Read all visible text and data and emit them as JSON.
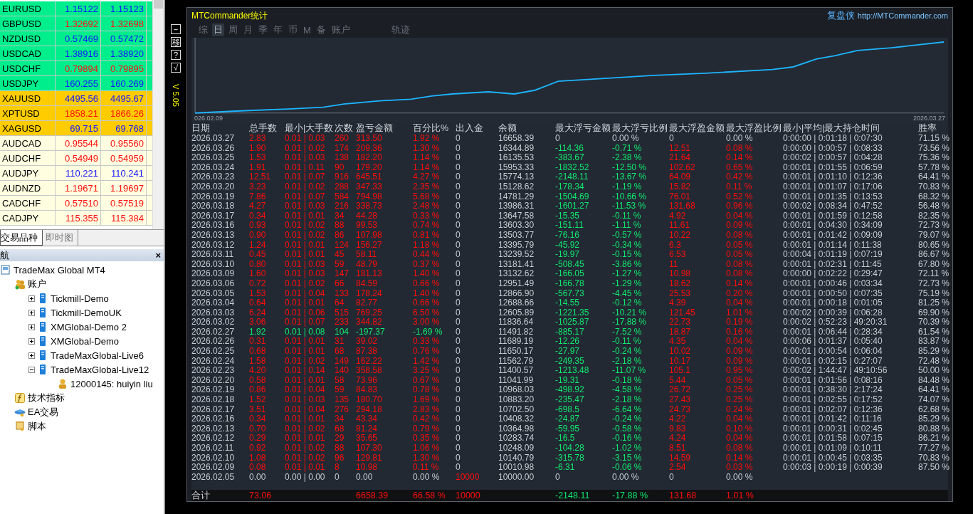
{
  "market_watch": {
    "symbols": [
      {
        "symbol": "EURUSD",
        "bid": "1.15122",
        "ask": "1.15123",
        "kind": "major",
        "rising": true
      },
      {
        "symbol": "GBPUSD",
        "bid": "1.32692",
        "ask": "1.32698",
        "kind": "major",
        "rising": false
      },
      {
        "symbol": "NZDUSD",
        "bid": "0.57469",
        "ask": "0.57472",
        "kind": "major",
        "rising": true
      },
      {
        "symbol": "USDCAD",
        "bid": "1.38916",
        "ask": "1.38920",
        "kind": "major",
        "rising": true
      },
      {
        "symbol": "USDCHF",
        "bid": "0.79894",
        "ask": "0.79895",
        "kind": "major",
        "rising": false
      },
      {
        "symbol": "USDJPY",
        "bid": "160.255",
        "ask": "160.269",
        "kind": "major",
        "rising": true
      },
      {
        "symbol": "XAUUSD",
        "bid": "4495.56",
        "ask": "4495.67",
        "kind": "metal",
        "rising": true
      },
      {
        "symbol": "XPTUSD",
        "bid": "1858.21",
        "ask": "1866.26",
        "kind": "metal",
        "rising": false
      },
      {
        "symbol": "XAGUSD",
        "bid": "69.715",
        "ask": "69.768",
        "kind": "metal",
        "rising": true
      },
      {
        "symbol": "AUDCAD",
        "bid": "0.95544",
        "ask": "0.95560",
        "kind": "cross",
        "rising": false
      },
      {
        "symbol": "AUDCHF",
        "bid": "0.54949",
        "ask": "0.54959",
        "kind": "cross",
        "rising": false
      },
      {
        "symbol": "AUDJPY",
        "bid": "110.221",
        "ask": "110.241",
        "kind": "cross",
        "rising": true
      },
      {
        "symbol": "AUDNZD",
        "bid": "1.19671",
        "ask": "1.19697",
        "kind": "cross",
        "rising": false
      },
      {
        "symbol": "CADCHF",
        "bid": "0.57510",
        "ask": "0.57519",
        "kind": "cross",
        "rising": false
      },
      {
        "symbol": "CADJPY",
        "bid": "115.355",
        "ask": "115.384",
        "kind": "cross",
        "rising": false
      }
    ],
    "tabs": [
      {
        "label": "交易品种",
        "selected": true
      },
      {
        "label": "即时图",
        "selected": false
      }
    ]
  },
  "navigator": {
    "title": "航",
    "close": "×",
    "root": {
      "label": "TradeMax Global MT4",
      "kind": "terminal",
      "children": [
        {
          "label": "账户",
          "kind": "accounts",
          "children": [
            {
              "label": "Tickmill-Demo",
              "kind": "server",
              "expanded": false
            },
            {
              "label": "Tickmill-DemoUK",
              "kind": "server",
              "expanded": false
            },
            {
              "label": "XMGlobal-Demo 2",
              "kind": "server",
              "expanded": false
            },
            {
              "label": "XMGlobal-Demo",
              "kind": "server",
              "expanded": false
            },
            {
              "label": "TradeMaxGlobal-Live6",
              "kind": "server",
              "expanded": false
            },
            {
              "label": "TradeMaxGlobal-Live12",
              "kind": "server",
              "expanded": true,
              "children": [
                {
                  "label": "12000145: huiyin liu",
                  "kind": "user"
                }
              ]
            }
          ]
        },
        {
          "label": "技术指标",
          "kind": "indicator"
        },
        {
          "label": "EA交易",
          "kind": "expert"
        },
        {
          "label": "脚本",
          "kind": "script"
        }
      ]
    }
  },
  "side_buttons": [
    "−",
    "移",
    "?",
    "√"
  ],
  "version": "V 5.05",
  "panel": {
    "title": "MTCommander统计",
    "brand": "复盘侠",
    "link": "http://MTCommander.com",
    "tabs": [
      {
        "label": "综",
        "selected": false
      },
      {
        "label": "日",
        "selected": true
      },
      {
        "label": "周",
        "selected": false
      },
      {
        "label": "月",
        "selected": false
      },
      {
        "label": "季",
        "selected": false
      },
      {
        "label": "年",
        "selected": false
      },
      {
        "label": "币",
        "selected": false
      },
      {
        "label": "M",
        "selected": false
      },
      {
        "label": "备",
        "selected": false
      },
      {
        "label": "账户",
        "selected": false
      },
      {
        "label": "轨迹",
        "selected": false
      }
    ],
    "chart": {
      "start_label": "026.02.09",
      "end_label": "2026.03.27"
    },
    "table": {
      "columns": [
        "日期",
        "总手数",
        "最小|大手数",
        "次数",
        "盈亏金额",
        "百分比%",
        "出入金",
        "余额",
        "最大浮亏金额",
        "最大浮亏比例",
        "最大浮盈金额",
        "最大浮盈比例",
        "最小|平均|最大持仓时间",
        "胜率"
      ],
      "rows": [
        {
          "kind": "gain",
          "floating": false,
          "cash_in": false,
          "cells": [
            "2026.03.27",
            "2.83",
            "0.01 | 0.03",
            "260",
            "313.50",
            "1.92 %",
            "0",
            "16658.39",
            "0",
            "0.00 %",
            "0",
            "0.00 %",
            "0:00:00 | 0:01:18 | 0:07:30",
            "71.15 %"
          ]
        },
        {
          "kind": "gain",
          "floating": true,
          "cash_in": false,
          "cells": [
            "2026.03.26",
            "1.90",
            "0.01 | 0.02",
            "174",
            "209.36",
            "1.30 %",
            "0",
            "16344.89",
            "-114.36",
            "-0.71 %",
            "12.51",
            "0.08 %",
            "0:00:00 | 0:00:57 | 0:08:33",
            "73.56 %"
          ]
        },
        {
          "kind": "gain",
          "floating": true,
          "cash_in": false,
          "cells": [
            "2026.03.25",
            "1.53",
            "0.01 | 0.03",
            "138",
            "182.20",
            "1.14 %",
            "0",
            "16135.53",
            "-383.67",
            "-2.38 %",
            "21.64",
            "0.14 %",
            "0:00:02 | 0:00:57 | 0:04:28",
            "75.36 %"
          ]
        },
        {
          "kind": "gain",
          "floating": true,
          "cash_in": false,
          "cells": [
            "2026.03.24",
            "1.91",
            "0.01 | 0.11",
            "90",
            "179.20",
            "1.14 %",
            "0",
            "15953.33",
            "-1832.52",
            "-12.50 %",
            "102.62",
            "0.65 %",
            "0:00:01 | 0:01:55 | 0:06:59",
            "57.78 %"
          ]
        },
        {
          "kind": "gain",
          "floating": true,
          "cash_in": false,
          "cells": [
            "2026.03.23",
            "12.51",
            "0.01 | 0.07",
            "916",
            "645.51",
            "4.27 %",
            "0",
            "15774.13",
            "-2148.11",
            "-13.67 %",
            "64.09",
            "0.42 %",
            "0:00:01 | 0:01:10 | 0:12:36",
            "64.41 %"
          ]
        },
        {
          "kind": "gain",
          "floating": true,
          "cash_in": false,
          "cells": [
            "2026.03.20",
            "3.23",
            "0.01 | 0.02",
            "288",
            "347.33",
            "2.35 %",
            "0",
            "15128.62",
            "-178.34",
            "-1.19 %",
            "15.82",
            "0.11 %",
            "0:00:01 | 0:01:07 | 0:17:06",
            "70.83 %"
          ]
        },
        {
          "kind": "gain",
          "floating": true,
          "cash_in": false,
          "cells": [
            "2026.03.19",
            "7.86",
            "0.01 | 0.07",
            "584",
            "794.98",
            "5.68 %",
            "0",
            "14781.29",
            "-1504.69",
            "-10.66 %",
            "76.01",
            "0.52 %",
            "0:00:01 | 0:01:35 | 0:13:53",
            "68.32 %"
          ]
        },
        {
          "kind": "gain",
          "floating": true,
          "cash_in": false,
          "cells": [
            "2026.03.18",
            "4.27",
            "0.01 | 0.03",
            "216",
            "338.73",
            "2.48 %",
            "0",
            "13986.31",
            "-1601.27",
            "-11.53 %",
            "131.68",
            "0.96 %",
            "0:00:02 | 0:08:34 | 0:47:52",
            "56.48 %"
          ]
        },
        {
          "kind": "gain",
          "floating": true,
          "cash_in": false,
          "cells": [
            "2026.03.17",
            "0.34",
            "0.01 | 0.01",
            "34",
            "44.28",
            "0.33 %",
            "0",
            "13647.58",
            "-15.35",
            "-0.11 %",
            "4.92",
            "0.04 %",
            "0:00:01 | 0:01:59 | 0:12:58",
            "82.35 %"
          ]
        },
        {
          "kind": "gain",
          "floating": true,
          "cash_in": false,
          "cells": [
            "2026.03.16",
            "0.93",
            "0.01 | 0.02",
            "88",
            "99.53",
            "0.74 %",
            "0",
            "13603.30",
            "-151.11",
            "-1.11 %",
            "11.61",
            "0.09 %",
            "0:00:01 | 0:04:30 | 0:34:09",
            "72.73 %"
          ]
        },
        {
          "kind": "gain",
          "floating": true,
          "cash_in": false,
          "cells": [
            "2026.03.13",
            "0.90",
            "0.01 | 0.02",
            "86",
            "107.98",
            "0.81 %",
            "0",
            "13503.77",
            "-76.16",
            "-0.57 %",
            "10.22",
            "0.08 %",
            "0:00:01 | 0:01:42 | 0:09:09",
            "79.07 %"
          ]
        },
        {
          "kind": "gain",
          "floating": true,
          "cash_in": false,
          "cells": [
            "2026.03.12",
            "1.24",
            "0.01 | 0.01",
            "124",
            "156.27",
            "1.18 %",
            "0",
            "13395.79",
            "-45.92",
            "-0.34 %",
            "6.3",
            "0.05 %",
            "0:00:01 | 0:01:14 | 0:11:38",
            "80.65 %"
          ]
        },
        {
          "kind": "gain",
          "floating": true,
          "cash_in": false,
          "cells": [
            "2026.03.11",
            "0.45",
            "0.01 | 0.01",
            "45",
            "58.11",
            "0.44 %",
            "0",
            "13239.52",
            "-19.97",
            "-0.15 %",
            "6.53",
            "0.05 %",
            "0:00:04 | 0:01:19 | 0:07:19",
            "86.67 %"
          ]
        },
        {
          "kind": "gain",
          "floating": true,
          "cash_in": false,
          "cells": [
            "2026.03.10",
            "0.80",
            "0.01 | 0.03",
            "59",
            "48.79",
            "0.37 %",
            "0",
            "13181.41",
            "-508.45",
            "-3.86 %",
            "11",
            "0.08 %",
            "0:00:01 | 0:02:31 | 0:11:45",
            "67.80 %"
          ]
        },
        {
          "kind": "gain",
          "floating": true,
          "cash_in": false,
          "cells": [
            "2026.03.09",
            "1.60",
            "0.01 | 0.03",
            "147",
            "181.13",
            "1.40 %",
            "0",
            "13132.62",
            "-166.05",
            "-1.27 %",
            "10.98",
            "0.08 %",
            "0:00:00 | 0:02:22 | 0:29:47",
            "72.11 %"
          ]
        },
        {
          "kind": "gain",
          "floating": true,
          "cash_in": false,
          "cells": [
            "2026.03.06",
            "0.72",
            "0.01 | 0.02",
            "66",
            "84.59",
            "0.66 %",
            "0",
            "12951.49",
            "-166.78",
            "-1.29 %",
            "18.62",
            "0.14 %",
            "0:00:01 | 0:00:46 | 0:03:34",
            "72.73 %"
          ]
        },
        {
          "kind": "gain",
          "floating": true,
          "cash_in": false,
          "cells": [
            "2026.03.05",
            "1.53",
            "0.01 | 0.04",
            "133",
            "178.24",
            "1.40 %",
            "0",
            "12866.90",
            "-567.73",
            "-4.45 %",
            "25.53",
            "0.20 %",
            "0:00:01 | 0:00:50 | 0:07:35",
            "75.19 %"
          ]
        },
        {
          "kind": "gain",
          "floating": true,
          "cash_in": false,
          "cells": [
            "2026.03.04",
            "0.64",
            "0.01 | 0.01",
            "64",
            "82.77",
            "0.66 %",
            "0",
            "12688.66",
            "-14.55",
            "-0.12 %",
            "4.39",
            "0.04 %",
            "0:00:01 | 0:00:18 | 0:01:05",
            "81.25 %"
          ]
        },
        {
          "kind": "gain",
          "floating": true,
          "cash_in": false,
          "cells": [
            "2026.03.03",
            "6.24",
            "0.01 | 0.06",
            "515",
            "769.25",
            "6.50 %",
            "0",
            "12605.89",
            "-1221.35",
            "-10.21 %",
            "121.45",
            "1.01 %",
            "0:00:02 | 0:00:39 | 0:06:28",
            "69.90 %"
          ]
        },
        {
          "kind": "gain",
          "floating": true,
          "cash_in": false,
          "cells": [
            "2026.03.02",
            "3.06",
            "0.01 | 0.07",
            "233",
            "344.82",
            "3.00 %",
            "0",
            "11836.64",
            "-1025.87",
            "-17.88 %",
            "22.73",
            "0.19 %",
            "0:00:02 | 0:52:23 | 49:20:31",
            "70.39 %"
          ]
        },
        {
          "kind": "loss",
          "floating": true,
          "cash_in": false,
          "cells": [
            "2026.02.27",
            "1.92",
            "0.01 | 0.08",
            "104",
            "-197.37",
            "-1.69 %",
            "0",
            "11491.82",
            "-885.17",
            "-7.52 %",
            "18.87",
            "0.16 %",
            "0:00:01 | 0:06:44 | 0:28:34",
            "61.54 %"
          ]
        },
        {
          "kind": "gain",
          "floating": true,
          "cash_in": false,
          "cells": [
            "2026.02.26",
            "0.31",
            "0.01 | 0.01",
            "31",
            "39.02",
            "0.33 %",
            "0",
            "11689.19",
            "-12.26",
            "-0.11 %",
            "4.35",
            "0.04 %",
            "0:00:06 | 0:01:37 | 0:05:40",
            "83.87 %"
          ]
        },
        {
          "kind": "gain",
          "floating": true,
          "cash_in": false,
          "cells": [
            "2026.02.25",
            "0.68",
            "0.01 | 0.01",
            "68",
            "87.38",
            "0.76 %",
            "0",
            "11650.17",
            "-27.97",
            "-0.24 %",
            "10.02",
            "0.09 %",
            "0:00:01 | 0:00:54 | 0:06:04",
            "85.29 %"
          ]
        },
        {
          "kind": "gain",
          "floating": true,
          "cash_in": false,
          "cells": [
            "2026.02.24",
            "1.58",
            "0.01 | 0.02",
            "149",
            "162.22",
            "1.42 %",
            "0",
            "11562.79",
            "-249.35",
            "-2.18 %",
            "10.17",
            "0.09 %",
            "0:00:01 | 0:02:15 | 0:27:07",
            "72.48 %"
          ]
        },
        {
          "kind": "gain",
          "floating": true,
          "cash_in": false,
          "cells": [
            "2026.02.23",
            "4.20",
            "0.01 | 0.14",
            "140",
            "358.58",
            "3.25 %",
            "0",
            "11400.57",
            "-1213.48",
            "-11.07 %",
            "105.1",
            "0.95 %",
            "0:00:02 | 1:44:47 | 49:10:56",
            "50.00 %"
          ]
        },
        {
          "kind": "gain",
          "floating": true,
          "cash_in": false,
          "cells": [
            "2026.02.20",
            "0.58",
            "0.01 | 0.01",
            "58",
            "73.96",
            "0.67 %",
            "0",
            "11041.99",
            "-19.31",
            "-0.18 %",
            "5.44",
            "0.05 %",
            "0:00:01 | 0:01:56 | 0:08:16",
            "84.48 %"
          ]
        },
        {
          "kind": "gain",
          "floating": true,
          "cash_in": false,
          "cells": [
            "2026.02.19",
            "0.86",
            "0.01 | 0.04",
            "59",
            "84.83",
            "0.78 %",
            "0",
            "10968.03",
            "-498.92",
            "-4.58 %",
            "26.72",
            "0.25 %",
            "0:00:01 | 0:38:30 | 2:17:24",
            "64.41 %"
          ]
        },
        {
          "kind": "gain",
          "floating": true,
          "cash_in": false,
          "cells": [
            "2026.02.18",
            "1.52",
            "0.01 | 0.03",
            "135",
            "180.70",
            "1.69 %",
            "0",
            "10883.20",
            "-235.47",
            "-2.18 %",
            "27.43",
            "0.25 %",
            "0:00:01 | 0:02:55 | 0:17:52",
            "74.07 %"
          ]
        },
        {
          "kind": "gain",
          "floating": true,
          "cash_in": false,
          "cells": [
            "2026.02.17",
            "3.51",
            "0.01 | 0.04",
            "276",
            "294.18",
            "2.83 %",
            "0",
            "10702.50",
            "-698.5",
            "-6.64 %",
            "24.73",
            "0.24 %",
            "0:00:01 | 0:02:07 | 0:12:36",
            "62.68 %"
          ]
        },
        {
          "kind": "gain",
          "floating": true,
          "cash_in": false,
          "cells": [
            "2026.02.16",
            "0.34",
            "0.01 | 0.01",
            "34",
            "43.34",
            "0.42 %",
            "0",
            "10408.32",
            "-24.87",
            "-0.24 %",
            "4.22",
            "0.04 %",
            "0:00:01 | 0:01:42 | 0:11:16",
            "85.29 %"
          ]
        },
        {
          "kind": "gain",
          "floating": true,
          "cash_in": false,
          "cells": [
            "2026.02.13",
            "0.70",
            "0.01 | 0.02",
            "68",
            "81.24",
            "0.79 %",
            "0",
            "10364.98",
            "-59.95",
            "-0.58 %",
            "9.83",
            "0.10 %",
            "0:00:01 | 0:00:31 | 0:02:45",
            "80.88 %"
          ]
        },
        {
          "kind": "gain",
          "floating": true,
          "cash_in": false,
          "cells": [
            "2026.02.12",
            "0.29",
            "0.01 | 0.01",
            "29",
            "35.65",
            "0.35 %",
            "0",
            "10283.74",
            "-16.5",
            "-0.16 %",
            "4.24",
            "0.04 %",
            "0:00:01 | 0:01:58 | 0:07:15",
            "86.21 %"
          ]
        },
        {
          "kind": "gain",
          "floating": true,
          "cash_in": false,
          "cells": [
            "2026.02.11",
            "0.92",
            "0.01 | 0.02",
            "88",
            "107.30",
            "1.06 %",
            "0",
            "10248.09",
            "-104.28",
            "-1.02 %",
            "8.51",
            "0.08 %",
            "0:00:01 | 0:01:09 | 0:10:11",
            "77.27 %"
          ]
        },
        {
          "kind": "gain",
          "floating": true,
          "cash_in": false,
          "cells": [
            "2026.02.10",
            "1.08",
            "0.01 | 0.02",
            "96",
            "129.81",
            "1.30 %",
            "0",
            "10140.79",
            "-315.78",
            "-3.15 %",
            "14.59",
            "0.14 %",
            "0:00:01 | 0:00:45 | 0:03:35",
            "70.83 %"
          ]
        },
        {
          "kind": "gain",
          "floating": true,
          "cash_in": false,
          "cells": [
            "2026.02.09",
            "0.08",
            "0.01 | 0.01",
            "8",
            "10.98",
            "0.11 %",
            "0",
            "10010.98",
            "-6.31",
            "-0.06 %",
            "2.54",
            "0.03 %",
            "0:00:03 | 0:00:19 | 0:00:39",
            "87.50 %"
          ]
        },
        {
          "kind": "flat",
          "floating": false,
          "cash_in": true,
          "cells": [
            "2026.02.05",
            "0.00",
            "0.00 | 0.00",
            "0",
            "0.00",
            "0.00 %",
            "10000",
            "10000.00",
            "0",
            "0.00 %",
            "0",
            "0.00 %"
          ]
        }
      ],
      "total": {
        "label": "合计",
        "lots": "73.06",
        "profit": "6658.39",
        "percent": "66.58 %",
        "cash": "10000",
        "max_float_loss": "-2148.11",
        "max_float_loss_pct": "-17.88 %",
        "max_float_profit": "131.68",
        "max_float_profit_pct": "1.01 %"
      }
    }
  }
}
